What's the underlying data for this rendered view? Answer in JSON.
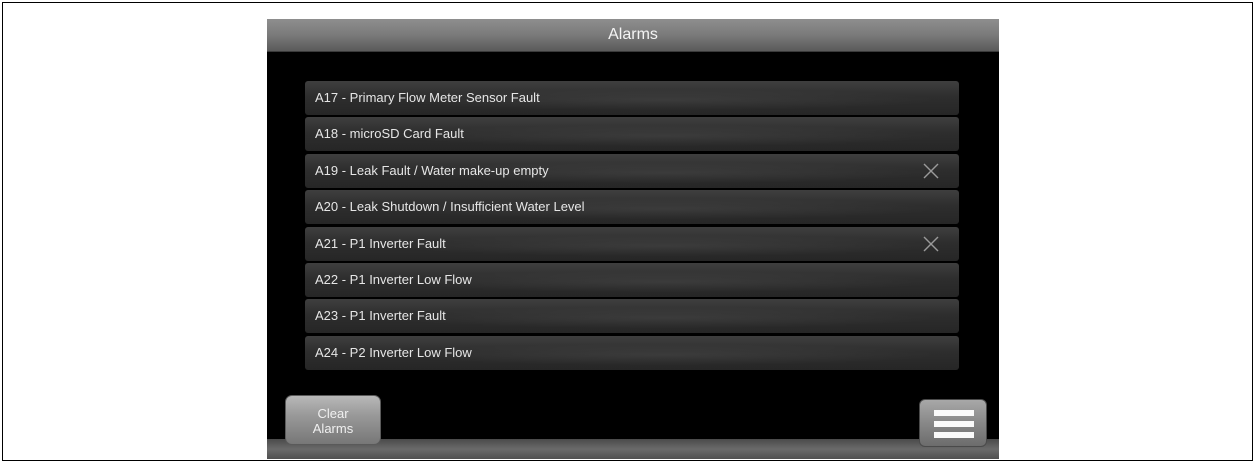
{
  "header": {
    "title": "Alarms"
  },
  "alarms": [
    {
      "label": "A17 - Primary Flow Meter Sensor Fault",
      "dismissable": false
    },
    {
      "label": "A18 - microSD Card Fault",
      "dismissable": false
    },
    {
      "label": "A19 - Leak Fault / Water make-up empty",
      "dismissable": true
    },
    {
      "label": "A20 - Leak Shutdown / Insufficient Water Level",
      "dismissable": false
    },
    {
      "label": "A21 - P1 Inverter Fault",
      "dismissable": true
    },
    {
      "label": "A22 - P1 Inverter Low Flow",
      "dismissable": false
    },
    {
      "label": "A23 - P1 Inverter Fault",
      "dismissable": false
    },
    {
      "label": "A24 - P2 Inverter Low Flow",
      "dismissable": false
    }
  ],
  "footer": {
    "clear_line1": "Clear",
    "clear_line2": "Alarms",
    "menu_icon": "hamburger-menu-icon"
  },
  "icons": {
    "dismiss": "close-x-icon"
  },
  "colors": {
    "screen_bg": "#000000",
    "row_bg": "#2e2e2e",
    "row_text": "#e6e6e6",
    "title_bar": "#7a7a7a"
  }
}
